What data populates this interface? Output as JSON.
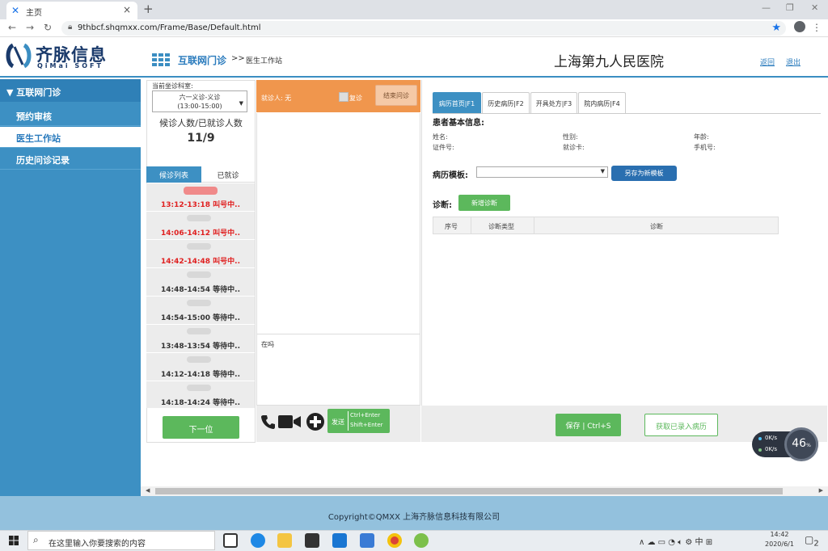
{
  "browser": {
    "tab_title": "主页",
    "url": "9thbcf.shqmxx.com/Frame/Base/Default.html"
  },
  "header": {
    "logo_cn": "齐脉信息",
    "logo_en": "QiMai SOFT",
    "nav_main": "互联网门诊",
    "nav_sep": ">>",
    "nav_sub": "医生工作站",
    "hospital": "上海第九人民医院",
    "back_label": "返回",
    "exit_label": "退出"
  },
  "sidebar": {
    "head": "互联网门诊",
    "items": [
      {
        "label": "预约审核"
      },
      {
        "label": "医生工作站"
      },
      {
        "label": "历史问诊记录"
      }
    ]
  },
  "queue": {
    "dept_label": "当前坐诊科室:",
    "dept_line1": "六一义诊-义诊",
    "dept_line2": "(13:00-15:00)",
    "count_label": "候诊人数/已就诊人数",
    "count_value": "11/9",
    "tab_waiting": "候诊列表",
    "tab_done": "已就诊",
    "rows": [
      {
        "time": "13:12-13:18 叫号中..",
        "status": "calling"
      },
      {
        "time": "14:06-14:12 叫号中..",
        "status": "calling"
      },
      {
        "time": "14:42-14:48 叫号中..",
        "status": "calling"
      },
      {
        "time": "14:48-14:54 等待中..",
        "status": "waiting"
      },
      {
        "time": "14:54-15:00 等待中..",
        "status": "waiting"
      },
      {
        "time": "13:48-13:54 等待中..",
        "status": "waiting"
      },
      {
        "time": "14:12-14:18 等待中..",
        "status": "waiting"
      },
      {
        "time": "14:18-14:24 等待中..",
        "status": "waiting"
      }
    ],
    "next_label": "下一位"
  },
  "chat": {
    "patient": "就诊人: 无",
    "revisit": "复诊",
    "end_label": "结束问诊",
    "input_text": "在吗",
    "send_label": "发送",
    "send_key1": "Ctrl+Enter",
    "send_key2": "Shift+Enter"
  },
  "record": {
    "tabs": [
      {
        "label": "病历首页|F1"
      },
      {
        "label": "历史病历|F2"
      },
      {
        "label": "开具处方|F3"
      },
      {
        "label": "院内病历|F4"
      }
    ],
    "basic_title": "患者基本信息:",
    "field_name": "姓名:",
    "field_gender": "性别:",
    "field_age": "年龄:",
    "field_id": "证件号:",
    "field_card": "就诊卡:",
    "field_phone": "手机号:",
    "template_label": "病历模板:",
    "save_template": "另存为新模板",
    "diagnosis_label": "诊断:",
    "add_diagnosis": "新增诊断",
    "table_headers": [
      "序号",
      "诊断类型",
      "诊断"
    ],
    "save_label": "保存 | Ctrl+S",
    "fetch_label": "获取已录入病历"
  },
  "speed": {
    "up": "0K/s",
    "down": "0K/s",
    "percent": "46",
    "percent_unit": "%"
  },
  "footer": {
    "copyright": "Copyright©QMXX 上海齐脉信息科技有限公司"
  },
  "taskbar": {
    "search_placeholder": "在这里输入你要搜索的内容",
    "ime": "中",
    "time": "14:42",
    "date": "2020/6/1",
    "notif_count": "2"
  },
  "colors": {
    "accent": "#3d90c3",
    "orange": "#f0964d",
    "green": "#5cb85c",
    "calling": "#e02020"
  }
}
